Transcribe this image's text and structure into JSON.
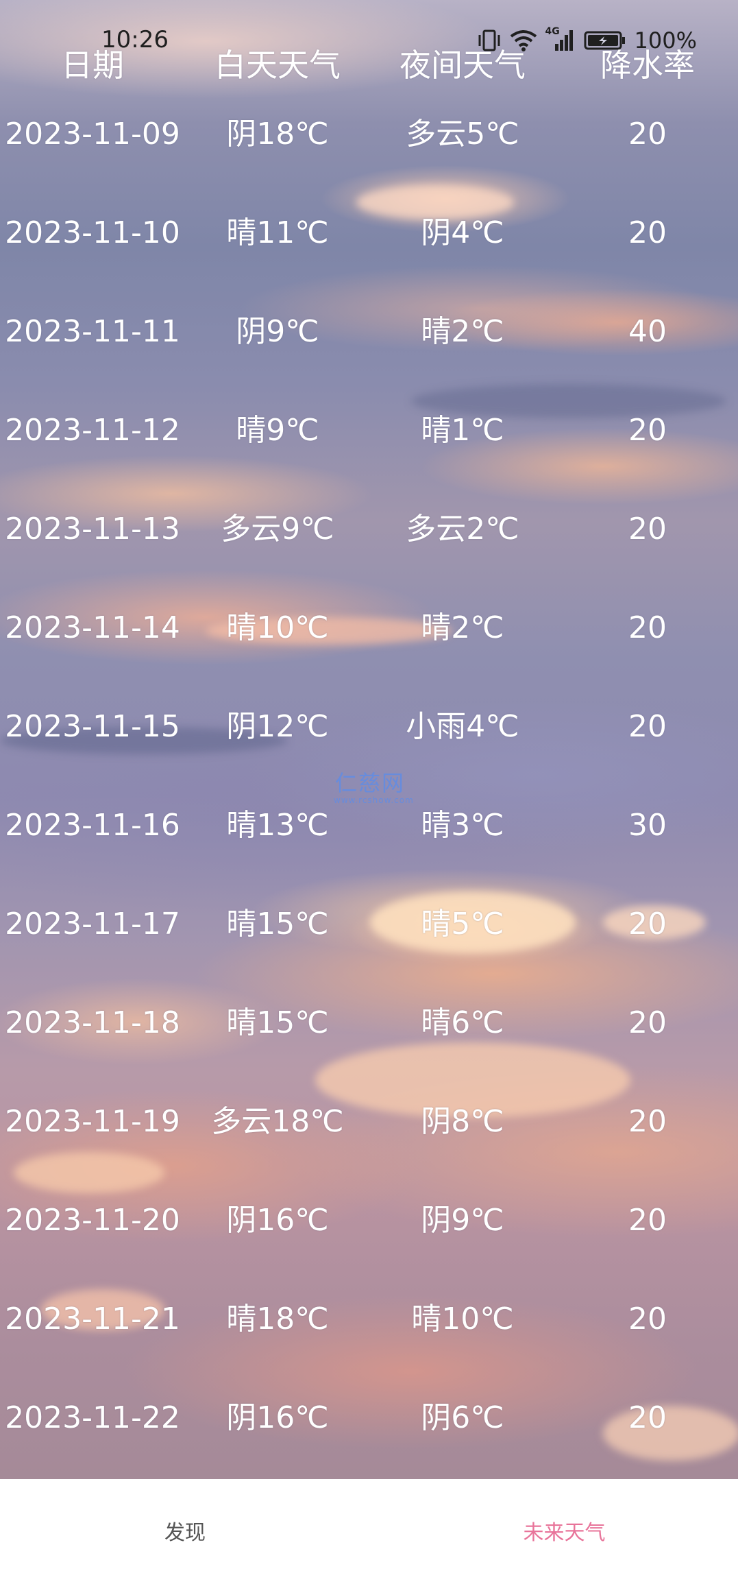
{
  "status_bar": {
    "time": "10:26",
    "network": "4G",
    "battery": "100%"
  },
  "table": {
    "headers": {
      "date": "日期",
      "day": "白天天气",
      "night": "夜间天气",
      "rain": "降水率"
    },
    "rows": [
      {
        "date": "2023-11-09",
        "day": "阴18℃",
        "night": "多云5℃",
        "rain": "20"
      },
      {
        "date": "2023-11-10",
        "day": "晴11℃",
        "night": "阴4℃",
        "rain": "20"
      },
      {
        "date": "2023-11-11",
        "day": "阴9℃",
        "night": "晴2℃",
        "rain": "40"
      },
      {
        "date": "2023-11-12",
        "day": "晴9℃",
        "night": "晴1℃",
        "rain": "20"
      },
      {
        "date": "2023-11-13",
        "day": "多云9℃",
        "night": "多云2℃",
        "rain": "20"
      },
      {
        "date": "2023-11-14",
        "day": "晴10℃",
        "night": "晴2℃",
        "rain": "20"
      },
      {
        "date": "2023-11-15",
        "day": "阴12℃",
        "night": "小雨4℃",
        "rain": "20"
      },
      {
        "date": "2023-11-16",
        "day": "晴13℃",
        "night": "晴3℃",
        "rain": "30"
      },
      {
        "date": "2023-11-17",
        "day": "晴15℃",
        "night": "晴5℃",
        "rain": "20"
      },
      {
        "date": "2023-11-18",
        "day": "晴15℃",
        "night": "晴6℃",
        "rain": "20"
      },
      {
        "date": "2023-11-19",
        "day": "多云18℃",
        "night": "阴8℃",
        "rain": "20"
      },
      {
        "date": "2023-11-20",
        "day": "阴16℃",
        "night": "阴9℃",
        "rain": "20"
      },
      {
        "date": "2023-11-21",
        "day": "晴18℃",
        "night": "晴10℃",
        "rain": "20"
      },
      {
        "date": "2023-11-22",
        "day": "阴16℃",
        "night": "阴6℃",
        "rain": "20"
      }
    ]
  },
  "watermark": {
    "main": "仁慈网",
    "sub": "www.rcshow.com"
  },
  "bottom_nav": {
    "items": [
      {
        "label": "发现",
        "active": false
      },
      {
        "label": "未来天气",
        "active": true
      }
    ],
    "active_color": "#e8749a",
    "inactive_color": "#555555"
  }
}
